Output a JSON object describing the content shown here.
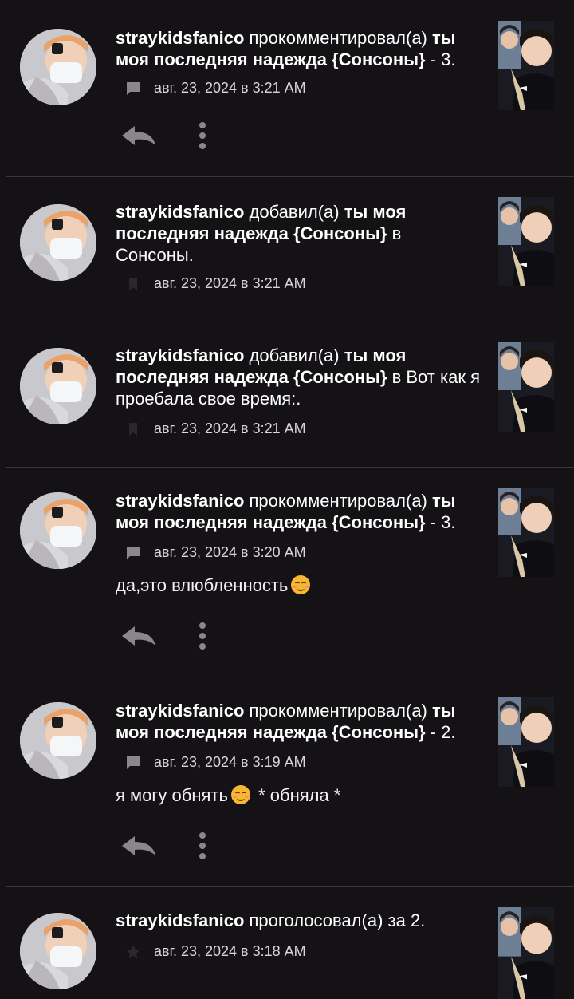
{
  "feed": {
    "items": [
      {
        "user": "straykidsfanico",
        "action": " прокомментировал(а) ",
        "story": "ты моя последняя надежда {Сонсоны}",
        "tail": " - 3.",
        "date": "авг. 23, 2024 в 3:21 AM",
        "meta_icon": "comment-icon",
        "comment": "",
        "has_actions": true
      },
      {
        "user": "straykidsfanico",
        "action": " добавил(а) ",
        "story": "ты моя последняя надежда {Сонсоны}",
        "tail": " в Сонсоны.",
        "date": "авг. 23, 2024 в 3:21 AM",
        "meta_icon": "add-to-list-icon",
        "comment": "",
        "has_actions": false
      },
      {
        "user": "straykidsfanico",
        "action": " добавил(а) ",
        "story": "ты моя последняя надежда {Сонсоны}",
        "tail": " в Вот как я проебала свое время:.",
        "date": "авг. 23, 2024 в 3:21 AM",
        "meta_icon": "add-to-list-icon",
        "comment": "",
        "has_actions": false
      },
      {
        "user": "straykidsfanico",
        "action": " прокомментировал(а) ",
        "story": "ты моя последняя надежда {Сонсоны}",
        "tail": " - 3.",
        "date": "авг. 23, 2024 в 3:20 AM",
        "meta_icon": "comment-icon",
        "comment_before": "да,это влюбленность",
        "comment_after": "",
        "has_actions": true
      },
      {
        "user": "straykidsfanico",
        "action": " прокомментировал(а) ",
        "story": "ты моя последняя надежда {Сонсоны}",
        "tail": " - 2.",
        "date": "авг. 23, 2024 в 3:19 AM",
        "meta_icon": "comment-icon",
        "comment_before": "я могу обнять",
        "comment_after": " * обняла *",
        "has_actions": true
      },
      {
        "user": "straykidsfanico",
        "action": " проголосовал(а) ",
        "story": "",
        "tail": "за 2.",
        "date": "авг. 23, 2024 в 3:18 AM",
        "meta_icon": "star-icon",
        "comment": "",
        "has_actions": false
      }
    ]
  },
  "colors": {
    "background": "#141215",
    "divider": "#3a373c",
    "text": "#ffffff",
    "meta_text": "#d8d6da",
    "icon": "#8a878c"
  }
}
